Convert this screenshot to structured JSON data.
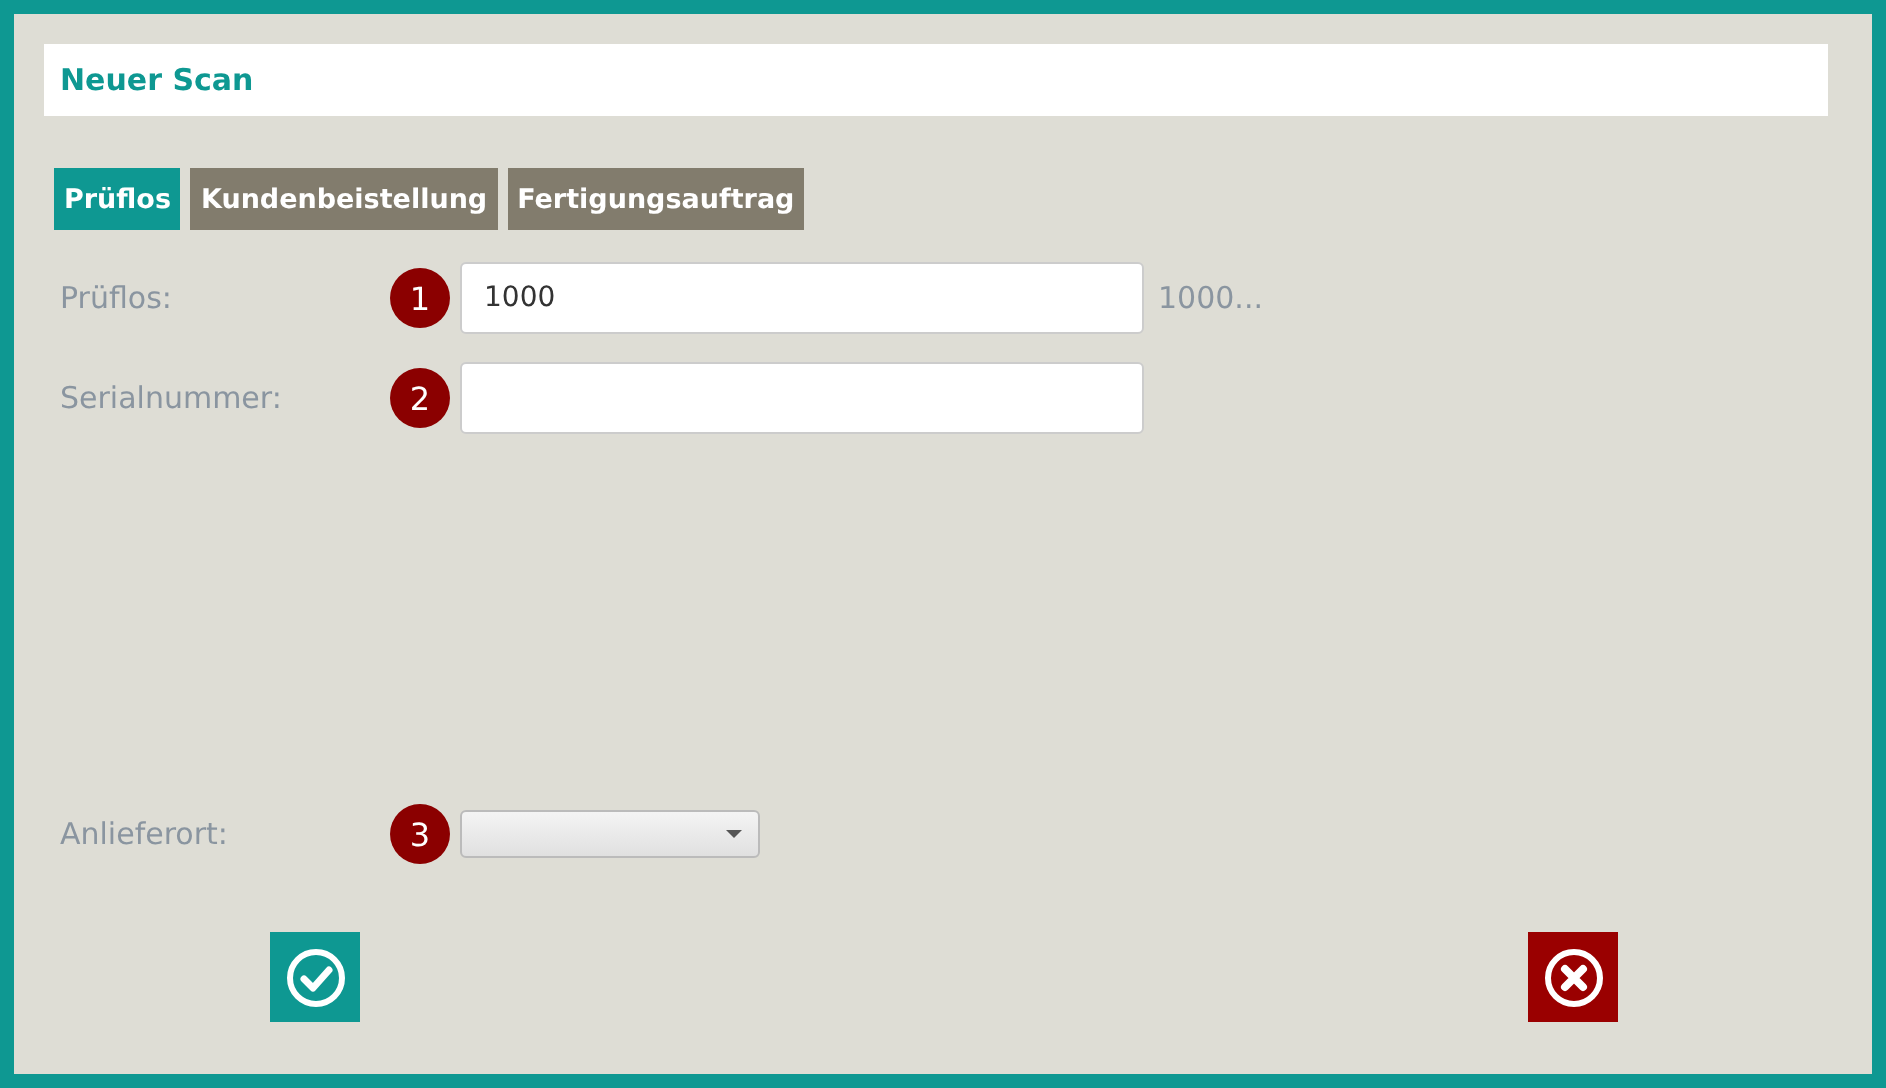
{
  "dialog": {
    "title": "Neuer Scan"
  },
  "tabs": [
    {
      "label": "Prüflos",
      "selected": true
    },
    {
      "label": "Kundenbeistellung",
      "selected": false
    },
    {
      "label": "Fertigungsauftrag",
      "selected": false
    }
  ],
  "fields": [
    {
      "kind": "text",
      "label": "Prüflos:",
      "step": "1",
      "value": "1000",
      "hint": "1000..."
    },
    {
      "kind": "text",
      "label": "Serialnummer:",
      "step": "2"
    },
    {
      "kind": "select",
      "label": "Anlieferort:",
      "step": "3"
    }
  ],
  "buttons": [
    {
      "kind": "confirm"
    },
    {
      "kind": "cancel"
    }
  ]
}
